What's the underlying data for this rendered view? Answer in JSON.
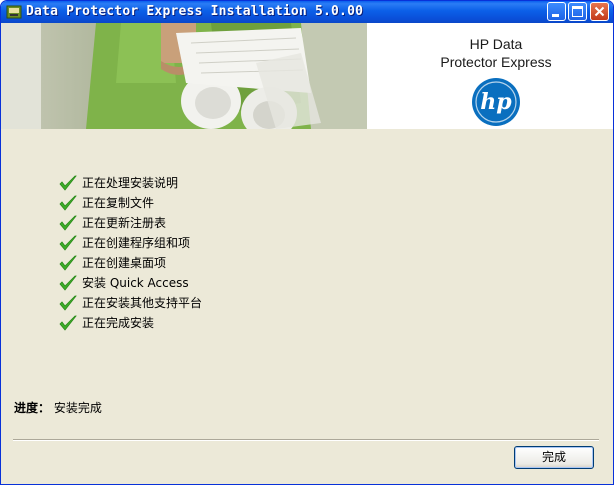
{
  "window": {
    "title": "Data Protector Express Installation 5.0.00",
    "controls": [
      "minimize",
      "maximize",
      "close"
    ]
  },
  "banner": {
    "product_line1": "HP Data",
    "product_line2": "Protector Express",
    "logo_text": "hp",
    "brand_color": "#0096d6"
  },
  "steps": [
    {
      "label": "正在处理安装说明",
      "status": "done"
    },
    {
      "label": "正在复制文件",
      "status": "done"
    },
    {
      "label": "正在更新注册表",
      "status": "done"
    },
    {
      "label": "正在创建程序组和项",
      "status": "done"
    },
    {
      "label": "正在创建桌面项",
      "status": "done"
    },
    {
      "label": "安装 Quick Access",
      "status": "done"
    },
    {
      "label": "正在安装其他支持平台",
      "status": "done"
    },
    {
      "label": "正在完成安装",
      "status": "done"
    }
  ],
  "progress": {
    "label": "进度：",
    "value": "安装完成"
  },
  "buttons": {
    "finish": "完成"
  },
  "colors": {
    "titlebar": "#0a5fef",
    "check": "#3fae2a",
    "window_bg": "#ece9d8"
  }
}
